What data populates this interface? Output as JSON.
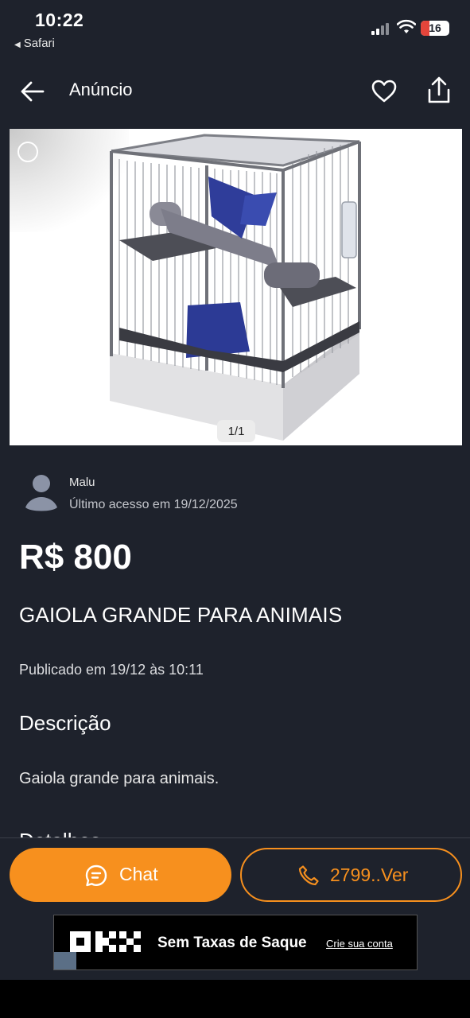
{
  "status_bar": {
    "time": "10:22",
    "back_app": "Safari",
    "battery": "16"
  },
  "nav": {
    "title": "Anúncio"
  },
  "gallery": {
    "counter": "1/1"
  },
  "seller": {
    "name": "Malu",
    "last_access": "Último acesso em 19/12/2025"
  },
  "listing": {
    "price": "R$ 800",
    "title": "GAIOLA GRANDE PARA ANIMAIS",
    "published": "Publicado em 19/12 às 10:11",
    "description_heading": "Descrição",
    "description": "Gaiola grande para animais.",
    "next_heading": "Detalhes"
  },
  "actions": {
    "chat_label": "Chat",
    "phone_label": "2799..Ver"
  },
  "ad": {
    "slogan": "Sem Taxas de Saque",
    "cta": "Crie sua conta",
    "brand": "OKX"
  },
  "colors": {
    "accent": "#f7901e",
    "background": "#1e222c"
  }
}
